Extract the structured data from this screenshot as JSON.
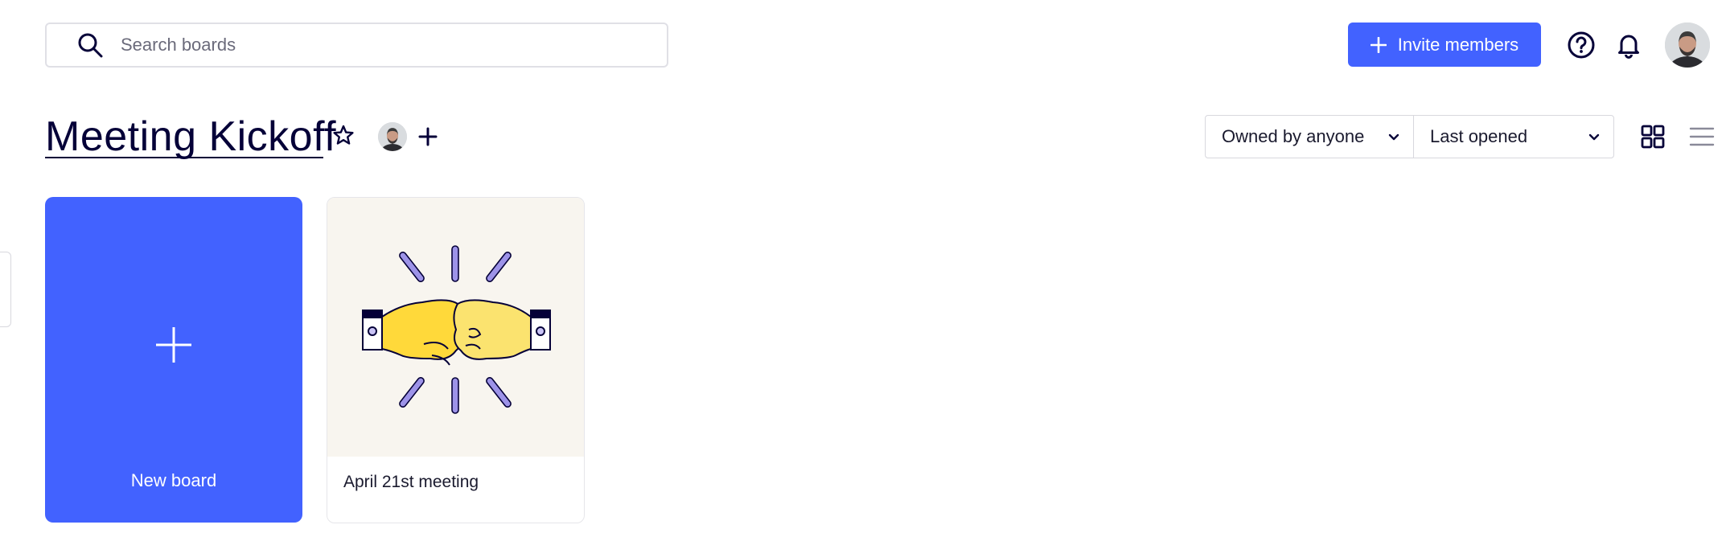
{
  "search": {
    "placeholder": "Search boards",
    "icon": "search-icon"
  },
  "header": {
    "invite_label": "Invite members",
    "help_icon": "question-circle-icon",
    "notification_icon": "bell-icon"
  },
  "page": {
    "title": "Meeting Kickoff",
    "star_icon": "star-icon"
  },
  "filters": {
    "owner": "Owned by anyone",
    "sort": "Last opened"
  },
  "views": {
    "grid_icon": "grid-view-icon",
    "list_icon": "list-view-icon"
  },
  "boards": {
    "new_label": "New board",
    "items": [
      {
        "name": "April 21st meeting"
      }
    ]
  },
  "colors": {
    "accent": "#4262ff",
    "text": "#050038",
    "thumb_bg": "#f8f5ef",
    "burst": "#9d93e8",
    "fist_left": "#ffd93a",
    "fist_right": "#fbe36f"
  }
}
